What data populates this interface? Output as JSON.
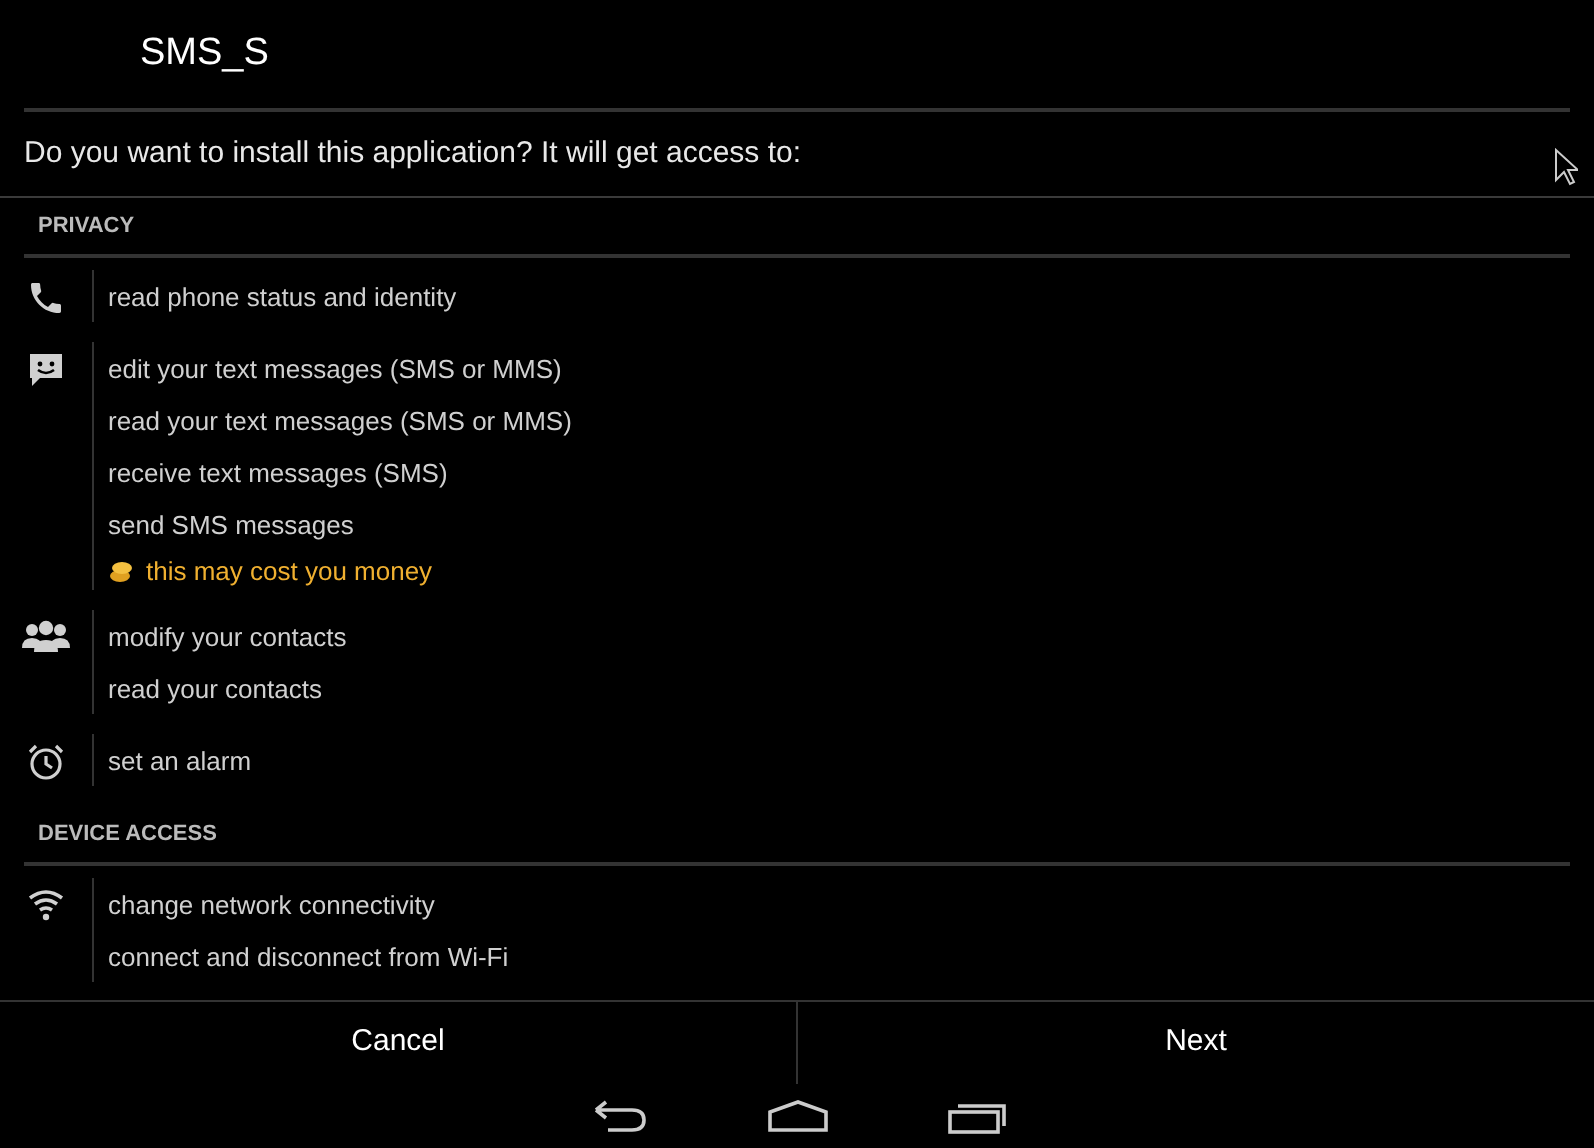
{
  "title": "SMS_S",
  "prompt": "Do you want to install this application? It will get access to:",
  "sections": [
    {
      "heading": "PRIVACY",
      "groups": [
        {
          "kind": "phone",
          "items": [
            {
              "text": "read phone status and identity"
            }
          ]
        },
        {
          "kind": "message",
          "items": [
            {
              "text": "edit your text messages (SMS or MMS)"
            },
            {
              "text": "read your text messages (SMS or MMS)"
            },
            {
              "text": "receive text messages (SMS)"
            },
            {
              "text": "send SMS messages",
              "warning": "this may cost you money"
            }
          ]
        },
        {
          "kind": "people",
          "items": [
            {
              "text": "modify your contacts"
            },
            {
              "text": "read your contacts"
            }
          ]
        },
        {
          "kind": "alarm",
          "items": [
            {
              "text": "set an alarm"
            }
          ]
        }
      ]
    },
    {
      "heading": "DEVICE ACCESS",
      "groups": [
        {
          "kind": "wifi",
          "items": [
            {
              "text": "change network connectivity"
            },
            {
              "text": "connect and disconnect from Wi-Fi"
            }
          ]
        }
      ]
    }
  ],
  "buttons": [
    "Cancel",
    "Next"
  ]
}
